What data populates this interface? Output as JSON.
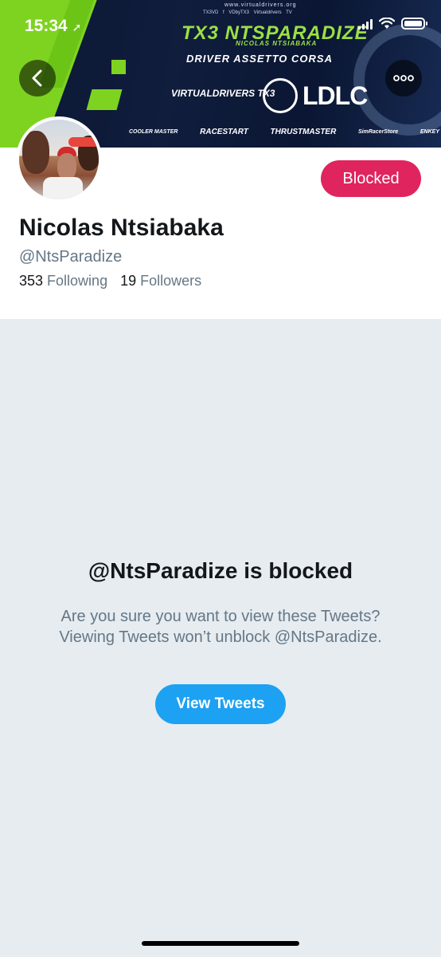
{
  "status_bar": {
    "time": "15:34"
  },
  "banner": {
    "url": "www.virtualdrivers.org",
    "social": "TX3VD f  VDbyTX3  Virtualdrivers TV",
    "title": "TX3 NTSPARADIZE",
    "subtitle": "NICOLAS NTSIABAKA",
    "driver_line": "DRIVER ASSETTO CORSA",
    "virtualdrivers": "VIRTUALDRIVERS TX3",
    "ldlc": "LDLC",
    "sponsors": [
      "COOLER MASTER",
      "RACESTART",
      "THRUSTMASTER",
      "SimRacerStore",
      "ENKEY"
    ]
  },
  "profile": {
    "blocked_label": "Blocked",
    "name": "Nicolas Ntsiabaka",
    "handle": "@NtsParadize",
    "following_count": "353",
    "following_label": "Following",
    "followers_count": "19",
    "followers_label": "Followers"
  },
  "blocked_notice": {
    "title": "@NtsParadize is blocked",
    "line1": "Are you sure you want to view these Tweets?",
    "line2": "Viewing Tweets won’t unblock @NtsParadize.",
    "button_label": "View Tweets"
  },
  "icons": {
    "back": "chevron-left-icon",
    "more": "more-horizontal-icon",
    "location": "location-arrow-icon",
    "signal": "signal-icon",
    "wifi": "wifi-icon",
    "battery": "battery-icon"
  },
  "colors": {
    "blocked": "#e0245e",
    "primary": "#1da1f2",
    "background": "#e6ecf0"
  }
}
